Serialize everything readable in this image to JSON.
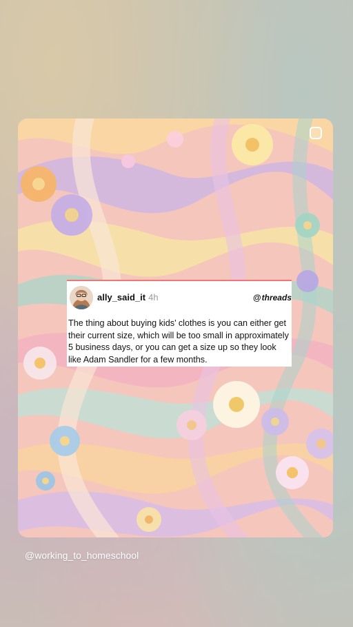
{
  "post": {
    "username": "ally_said_it",
    "age": "4h",
    "platform_label": "threads",
    "text": "The thing about buying kids’ clothes is you can either get their current size, which will be too small in approximately 5 business days, or you can get a size up so they look like Adam Sandler for a few months."
  },
  "watermark": "@working_to_homeschool",
  "icons": {
    "threads": "threads-logo-icon",
    "select": "select-square-icon"
  },
  "colors": {
    "post_border_accent": "#f17575",
    "background": "#c9bfb3"
  }
}
